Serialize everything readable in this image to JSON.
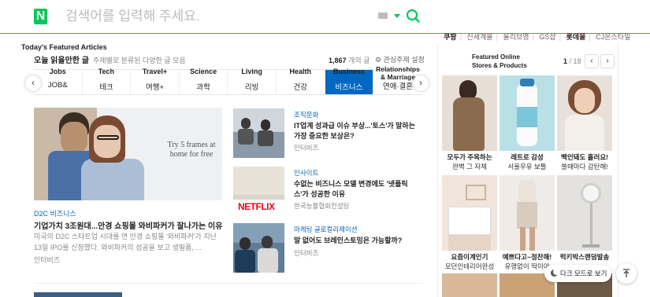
{
  "header": {
    "logo": "N",
    "search_placeholder": "검색어를 입력해 주세요."
  },
  "shop_links": {
    "items": [
      "쿠팡",
      "신세계몰",
      "올리브영",
      "GS샵",
      "롯데몰",
      "CJ온스타일"
    ],
    "bold_indexes": [
      0,
      4
    ]
  },
  "featured": {
    "title_en": "Today's Featured Articles",
    "title_ko": "오늘 읽을만한 글",
    "subtitle": "주제별로 분류된 다양한 글 모음",
    "count": "1,867",
    "count_suffix": "개의 글",
    "settings_label": "관심주제 설정"
  },
  "tabs": [
    {
      "en": "Jobs",
      "ko": "JOB&",
      "active": false
    },
    {
      "en": "Tech",
      "ko": "테크",
      "active": false
    },
    {
      "en": "Travel+",
      "ko": "여행+",
      "active": false
    },
    {
      "en": "Science",
      "ko": "과학",
      "active": false
    },
    {
      "en": "Living",
      "ko": "리빙",
      "active": false
    },
    {
      "en": "Health",
      "ko": "건강",
      "active": false
    },
    {
      "en": "Business",
      "ko": "비즈니스",
      "active": true
    },
    {
      "en": "Relationships & Marriage",
      "ko": "연애·결혼",
      "active": false
    }
  ],
  "main_article": {
    "image_text": "Try 5 frames at home for free",
    "category": "D2C 비즈니스",
    "title": "기업가치 3조원대...안경 쇼핑몰 와비파커가 잘나가는 이유",
    "description": "미국의 D2C 스타트업 시대를 연 안경 쇼핑몰 '와비파커'가 지난 13일 IPO를 신청했다. 와비파커의 성공을 보고 생필품, ...",
    "source": "인터비즈"
  },
  "side_articles": [
    {
      "category": "조직문화",
      "title": "IT업계 성과급 이슈 부상...'토스'가 말하는 가장 중요한 보상은?",
      "source": "인터비즈"
    },
    {
      "category": "인사이트",
      "title": "수없는 비즈니스 모델 변경에도 '넷플릭스'가 성공한 이유",
      "source": "한국능률협회컨설팅",
      "thumb_text": "NETFLIX"
    },
    {
      "category": "마케팅 글로컬리제이션",
      "title": "말 없어도 브레인스토밍은 가능할까?",
      "source": "인터비즈"
    }
  ],
  "shopping": {
    "title": "Featured Online Stores & Products",
    "page_current": "1",
    "page_total": "/ 18",
    "products": [
      {
        "name": "모두가 주목하는",
        "sub": "완벽 그 자체"
      },
      {
        "name": "레트로 감성",
        "sub": "서울우유 보틀"
      },
      {
        "name": "백인돼도 흘러요!",
        "sub": "쏠때마다 감탄해!"
      },
      {
        "name": "요즘이계인기",
        "sub": "모던인테리어완성"
      },
      {
        "name": "예쁘다고~정찬해!",
        "sub": "유행없이 딱이야"
      },
      {
        "name": "럭키박스랜덤발송",
        "sub": ""
      }
    ]
  },
  "dark_mode_label": "다크 모드로 보기",
  "colors": {
    "brand": "#03c75a",
    "accent": "#0068c3"
  }
}
